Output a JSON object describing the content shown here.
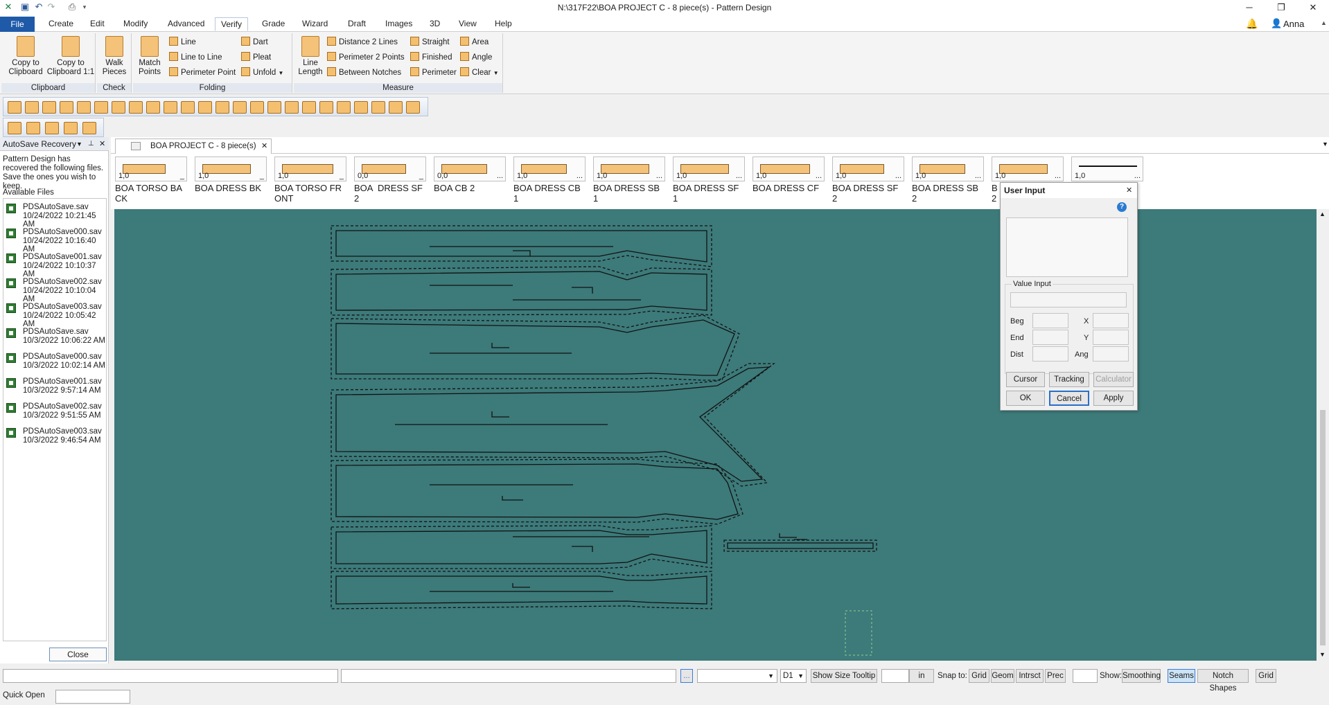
{
  "window": {
    "title": "N:\\317F22\\BOA PROJECT C  - 8 piece(s) - Pattern Design",
    "user": "Anna"
  },
  "menu": [
    {
      "label": "File"
    },
    {
      "label": "Create"
    },
    {
      "label": "Edit"
    },
    {
      "label": "Modify"
    },
    {
      "label": "Advanced"
    },
    {
      "label": "Verify"
    },
    {
      "label": "Grade"
    },
    {
      "label": "Wizard"
    },
    {
      "label": "Draft"
    },
    {
      "label": "Images"
    },
    {
      "label": "3D"
    },
    {
      "label": "View"
    },
    {
      "label": "Help"
    }
  ],
  "ribbon": {
    "clipboard": {
      "label": "Clipboard",
      "copy": "Copy to\nClipboard",
      "copy11": "Copy to\nClipboard 1:1"
    },
    "check": {
      "label": "Check",
      "walk": "Walk\nPieces"
    },
    "folding": {
      "label": "Folding",
      "match": "Match\nPoints",
      "line": "Line",
      "line_to_line": "Line to Line",
      "perimeter_point": "Perimeter Point",
      "dart": "Dart",
      "pleat": "Pleat",
      "unfold": "Unfold"
    },
    "measure": {
      "label": "Measure",
      "line_length": "Line\nLength",
      "distance2": "Distance 2 Lines",
      "perimeter2": "Perimeter 2 Points",
      "between_notches": "Between Notches",
      "straight": "Straight",
      "finished": "Finished",
      "perimeter": "Perimeter",
      "area": "Area",
      "angle": "Angle",
      "clear": "Clear"
    }
  },
  "left_panel": {
    "title": "AutoSave Recovery",
    "message": "Pattern Design has recovered the following files. Save the ones you wish to keep.",
    "available": "Available Files",
    "files": [
      {
        "name": "PDSAutoSave.sav",
        "date": "10/24/2022 10:21:45 AM"
      },
      {
        "name": "PDSAutoSave000.sav",
        "date": "10/24/2022 10:16:40 AM"
      },
      {
        "name": "PDSAutoSave001.sav",
        "date": "10/24/2022 10:10:37 AM"
      },
      {
        "name": "PDSAutoSave002.sav",
        "date": "10/24/2022 10:10:04 AM"
      },
      {
        "name": "PDSAutoSave003.sav",
        "date": "10/24/2022 10:05:42 AM"
      },
      {
        "name": "PDSAutoSave.sav",
        "date": "10/3/2022 10:06:22 AM"
      },
      {
        "name": "PDSAutoSave000.sav",
        "date": "10/3/2022 10:02:14 AM"
      },
      {
        "name": "PDSAutoSave001.sav",
        "date": "10/3/2022 9:57:14 AM"
      },
      {
        "name": "PDSAutoSave002.sav",
        "date": "10/3/2022 9:51:55 AM"
      },
      {
        "name": "PDSAutoSave003.sav",
        "date": "10/3/2022 9:46:54 AM"
      }
    ],
    "close": "Close"
  },
  "doc_tab": "BOA PROJECT C  - 8 piece(s)",
  "pieces": [
    {
      "num": "1,0",
      "dots": "_",
      "name": "BOA TORSO BA\nCK"
    },
    {
      "num": "1,0",
      "dots": "_",
      "name": "BOA DRESS BK"
    },
    {
      "num": "1,0",
      "dots": "_",
      "name": "BOA TORSO FR\nONT"
    },
    {
      "num": "0,0",
      "dots": "_",
      "name": "BOA  DRESS SF\n2"
    },
    {
      "num": "0,0",
      "dots": "...",
      "name": "BOA CB 2"
    },
    {
      "num": "1,0",
      "dots": "...",
      "name": "BOA DRESS CB\n1"
    },
    {
      "num": "1,0",
      "dots": "...",
      "name": "BOA DRESS SB\n1"
    },
    {
      "num": "1,0",
      "dots": "...",
      "name": "BOA DRESS SF\n1"
    },
    {
      "num": "1,0",
      "dots": "...",
      "name": "BOA DRESS CF"
    },
    {
      "num": "1,0",
      "dots": "...",
      "name": "BOA DRESS SF\n2"
    },
    {
      "num": "1,0",
      "dots": "...",
      "name": "BOA DRESS SB\n2"
    },
    {
      "num": "1,0",
      "dots": "...",
      "name": "B\n2"
    },
    {
      "num": "1,0",
      "dots": "...",
      "name": ""
    }
  ],
  "dialog": {
    "title": "User Input",
    "value_input": "Value Input",
    "beg": "Beg",
    "end": "End",
    "dist": "Dist",
    "x": "X",
    "y": "Y",
    "ang": "Ang",
    "cursor": "Cursor",
    "tracking": "Tracking",
    "calculator": "Calculator",
    "ok": "OK",
    "cancel": "Cancel",
    "apply": "Apply"
  },
  "status": {
    "dots": "...",
    "size": "D1",
    "show_size_tooltip": "Show Size Tooltip",
    "unit": "in",
    "snap_to": "Snap to:",
    "snap": [
      "Grid",
      "Geom",
      "Intrsct",
      "Prec"
    ],
    "show": "Show:",
    "show_opts": [
      "Smoothing",
      "Seams",
      "Notch Shapes",
      "Grid"
    ],
    "quick_open": "Quick Open"
  },
  "colors": {
    "canvas": "#3d7a7a",
    "file_tab": "#1e5aa8",
    "piece_fill": "#f5c27a"
  }
}
